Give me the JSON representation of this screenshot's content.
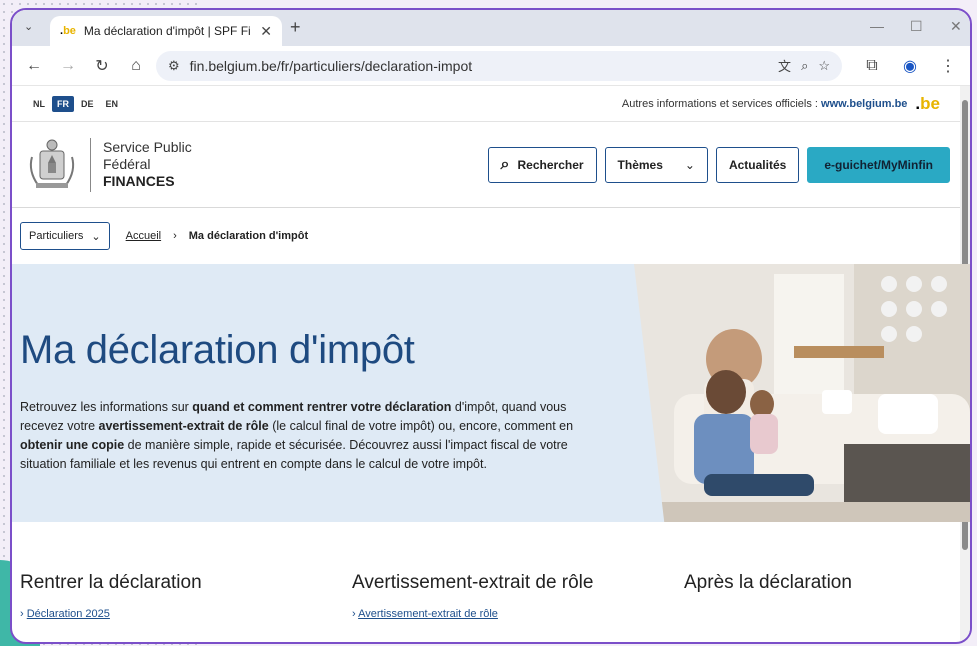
{
  "browser": {
    "tab_title": "Ma déclaration d'impôt | SPF Fi",
    "tab_favicon": ".be",
    "url": "fin.belgium.be/fr/particuliers/declaration-impot"
  },
  "site": {
    "languages": [
      "NL",
      "FR",
      "DE",
      "EN"
    ],
    "active_language": "FR",
    "other_info": "Autres informations et services officiels :",
    "other_info_link": "www.belgium.be",
    "org_line1": "Service Public",
    "org_line2": "Fédéral",
    "org_line3": "FINANCES",
    "nav": {
      "search": "Rechercher",
      "themes": "Thèmes",
      "news": "Actualités",
      "eguichet": "e-guichet/MyMinfin"
    },
    "selector": "Particuliers",
    "breadcrumb_home": "Accueil",
    "breadcrumb_current": "Ma déclaration d'impôt"
  },
  "hero": {
    "title": "Ma déclaration d'impôt",
    "p1": "Retrouvez les informations sur ",
    "p1_bold": "quand et comment rentrer votre déclaration",
    "p2": " d'impôt, quand vous recevez votre ",
    "p2_bold": "avertissement-extrait de rôle",
    "p3": " (le calcul final de votre impôt) ou, encore, comment en ",
    "p3_bold": "obtenir une copie",
    "p4": " de manière simple, rapide et sécurisée. Découvrez aussi l'impact fiscal de votre situation familiale et les revenus qui entrent en compte dans le calcul de votre impôt."
  },
  "sections": [
    {
      "title": "Rentrer la déclaration",
      "link": "Déclaration 2025"
    },
    {
      "title": "Avertissement-extrait de rôle",
      "link": "Avertissement-extrait de rôle"
    },
    {
      "title": "Après la déclaration",
      "link": ""
    }
  ],
  "colors": {
    "accent": "#1e4f8c",
    "teal": "#2aa9c4",
    "window_border": "#7b4fc9",
    "hero_bg": "#dfeaf5"
  }
}
